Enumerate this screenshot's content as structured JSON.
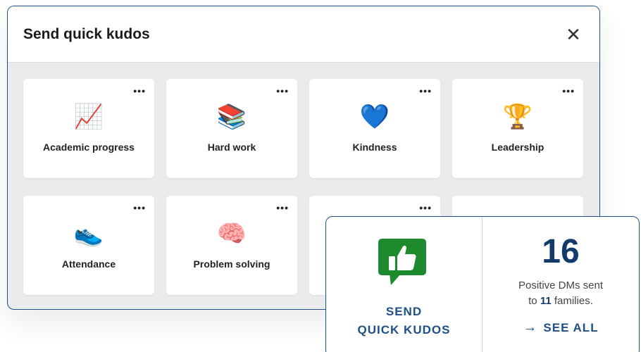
{
  "modal": {
    "title": "Send quick kudos",
    "close_glyph": "✕",
    "more_glyph": "•••",
    "cards": [
      {
        "label": "Academic progress",
        "emoji": "📈",
        "icon": "chart-increasing-icon"
      },
      {
        "label": "Hard work",
        "emoji": "📚",
        "icon": "books-icon"
      },
      {
        "label": "Kindness",
        "emoji": "💙",
        "icon": "blue-heart-icon"
      },
      {
        "label": "Leadership",
        "emoji": "🏆",
        "icon": "trophy-icon"
      },
      {
        "label": "Attendance",
        "emoji": "👟",
        "icon": "sneaker-icon"
      },
      {
        "label": "Problem solving",
        "emoji": "🧠",
        "icon": "brain-icon"
      }
    ]
  },
  "overlay": {
    "send_line1": "SEND",
    "send_line2": "QUICK KUDOS",
    "count": "16",
    "stat_prefix": "Positive DMs sent",
    "stat_to": "to",
    "families_count": "11",
    "stat_suffix": "families.",
    "see_all_label": "SEE ALL",
    "arrow_glyph": "→",
    "accent_color": "#1f4f86",
    "kudos_icon_color": "#1e8a2e"
  }
}
